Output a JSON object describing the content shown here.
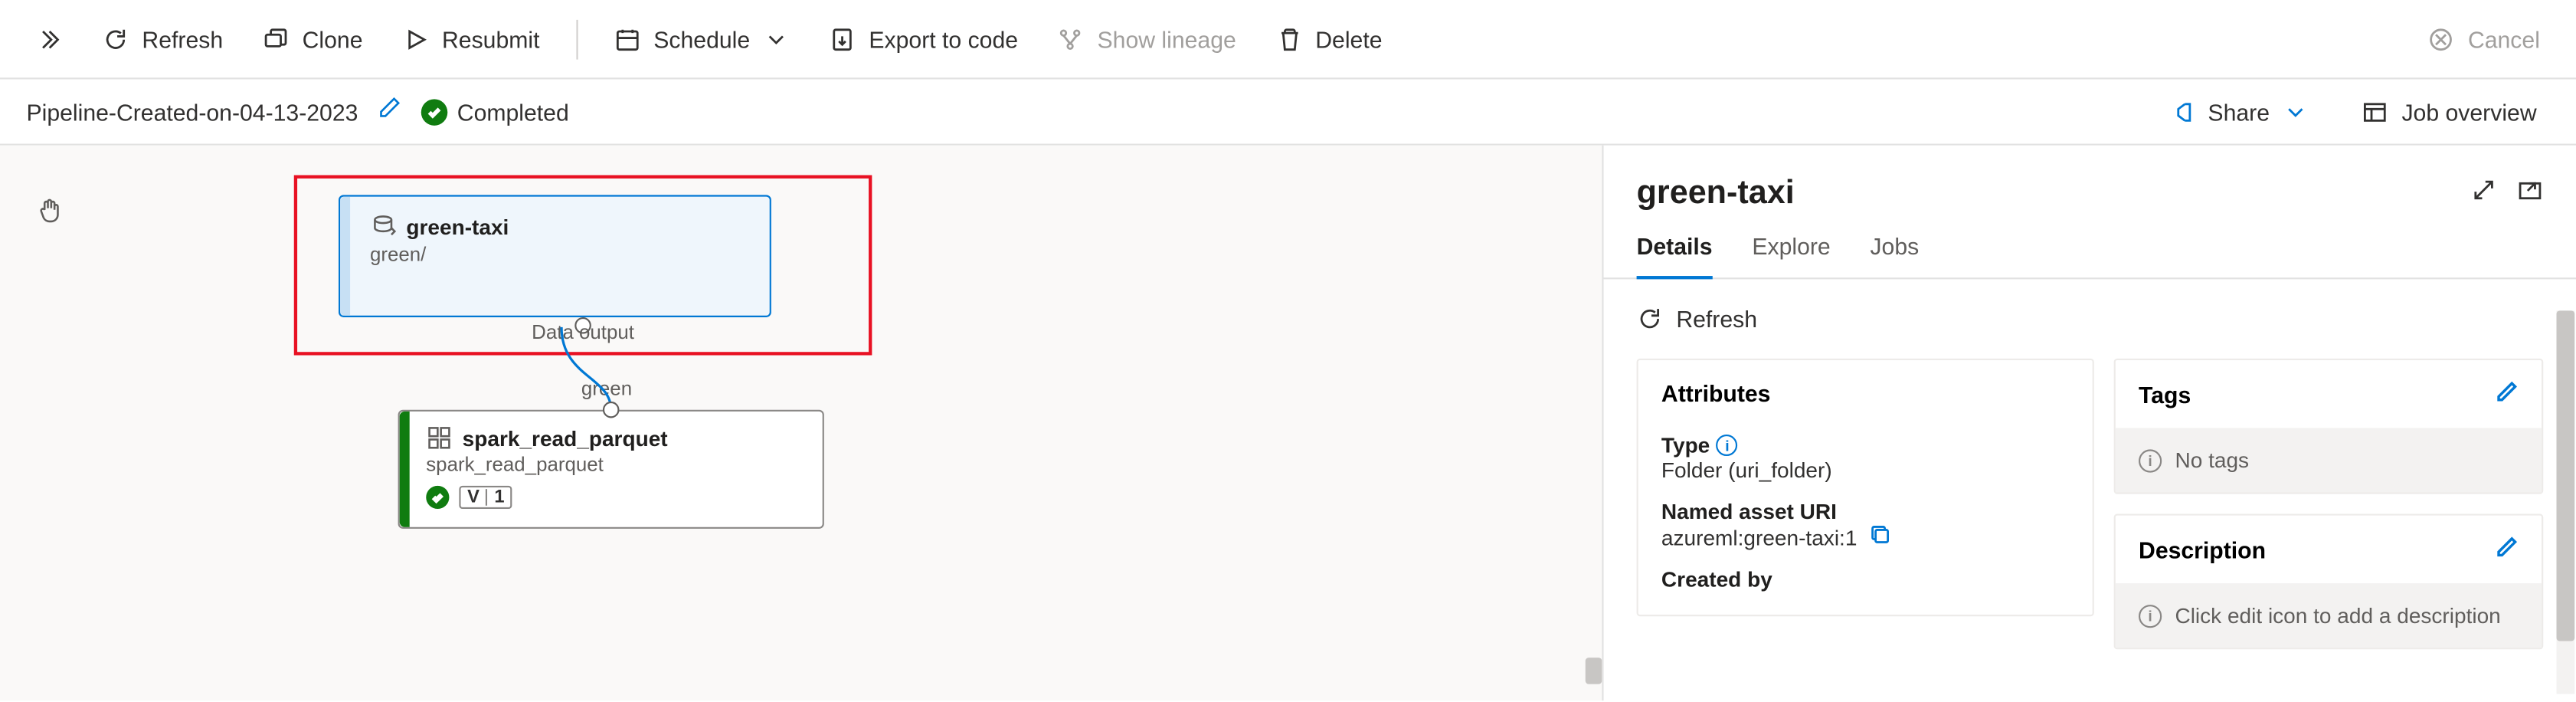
{
  "toolbar": {
    "refresh": "Refresh",
    "clone": "Clone",
    "resubmit": "Resubmit",
    "schedule": "Schedule",
    "export": "Export to code",
    "lineage": "Show lineage",
    "delete": "Delete",
    "cancel": "Cancel"
  },
  "pipeline": {
    "name": "Pipeline-Created-on-04-13-2023",
    "status": "Completed"
  },
  "header_buttons": {
    "share": "Share",
    "job_overview": "Job overview"
  },
  "graph": {
    "node1": {
      "title": "green-taxi",
      "subtitle": "green/",
      "output_label": "Data output"
    },
    "edge_label": "green",
    "node2": {
      "title": "spark_read_parquet",
      "subtitle": "spark_read_parquet",
      "version_letter": "V",
      "version_num": "1"
    }
  },
  "panel": {
    "title": "green-taxi",
    "tabs": {
      "details": "Details",
      "explore": "Explore",
      "jobs": "Jobs"
    },
    "refresh": "Refresh",
    "attributes": {
      "heading": "Attributes",
      "type_label": "Type",
      "type_value": "Folder (uri_folder)",
      "uri_label": "Named asset URI",
      "uri_value": "azureml:green-taxi:1",
      "createdby_label": "Created by"
    },
    "tags": {
      "heading": "Tags",
      "empty": "No tags"
    },
    "description": {
      "heading": "Description",
      "empty": "Click edit icon to add a description"
    }
  }
}
